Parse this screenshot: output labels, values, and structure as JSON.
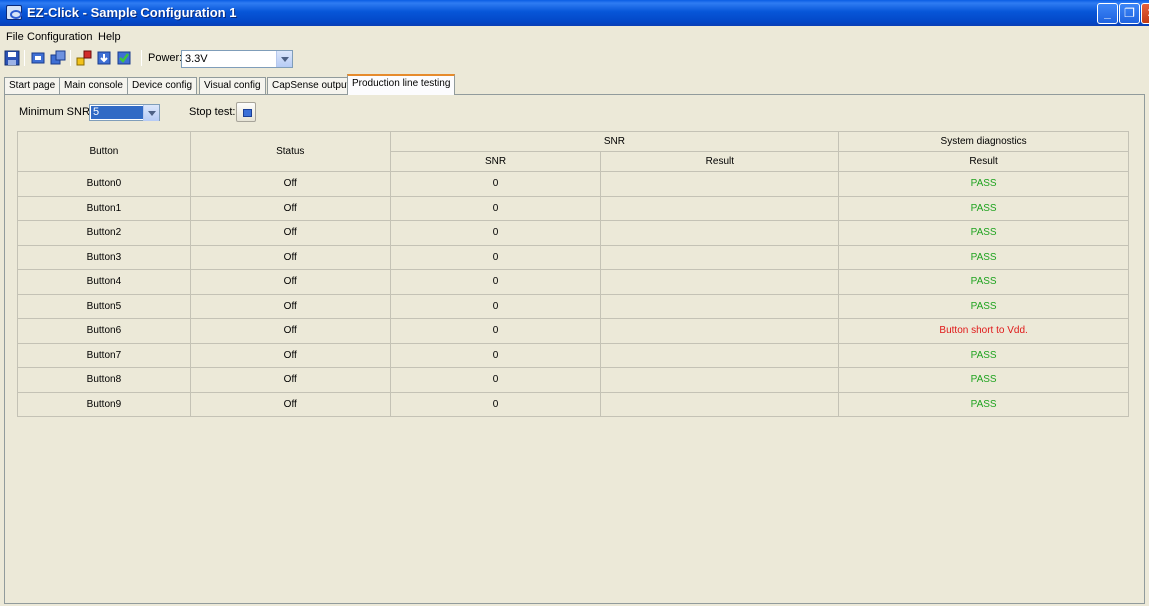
{
  "window": {
    "title": "EZ-Click - Sample Configuration 1"
  },
  "menu": {
    "file": "File",
    "configuration": "Configuration",
    "help": "Help"
  },
  "toolbar": {
    "icons": [
      "save-icon",
      "connect-icon",
      "device-icon",
      "configure-icon",
      "download-icon",
      "verify-icon"
    ],
    "power_label": "Power:",
    "power_value": "3.3V"
  },
  "tabs": [
    "Start page",
    "Main console",
    "Device config",
    "Visual config",
    "CapSense output",
    "Production line testing"
  ],
  "active_tab": "Production line testing",
  "controls": {
    "min_snr_label": "Minimum SNR:",
    "min_snr_value": "5",
    "stop_test_label": "Stop test:"
  },
  "table": {
    "headers": {
      "button": "Button",
      "status": "Status",
      "snr_group": "SNR",
      "snr": "SNR",
      "snr_result": "Result",
      "diag_group": "System diagnostics",
      "diag_result": "Result"
    },
    "rows": [
      {
        "button": "Button0",
        "status": "Off",
        "snr": "0",
        "result": "",
        "diag": "PASS",
        "diag_state": "pass"
      },
      {
        "button": "Button1",
        "status": "Off",
        "snr": "0",
        "result": "",
        "diag": "PASS",
        "diag_state": "pass"
      },
      {
        "button": "Button2",
        "status": "Off",
        "snr": "0",
        "result": "",
        "diag": "PASS",
        "diag_state": "pass"
      },
      {
        "button": "Button3",
        "status": "Off",
        "snr": "0",
        "result": "",
        "diag": "PASS",
        "diag_state": "pass"
      },
      {
        "button": "Button4",
        "status": "Off",
        "snr": "0",
        "result": "",
        "diag": "PASS",
        "diag_state": "pass"
      },
      {
        "button": "Button5",
        "status": "Off",
        "snr": "0",
        "result": "",
        "diag": "PASS",
        "diag_state": "pass"
      },
      {
        "button": "Button6",
        "status": "Off",
        "snr": "0",
        "result": "",
        "diag": "Button short to Vdd.",
        "diag_state": "fail"
      },
      {
        "button": "Button7",
        "status": "Off",
        "snr": "0",
        "result": "",
        "diag": "PASS",
        "diag_state": "pass"
      },
      {
        "button": "Button8",
        "status": "Off",
        "snr": "0",
        "result": "",
        "diag": "PASS",
        "diag_state": "pass"
      },
      {
        "button": "Button9",
        "status": "Off",
        "snr": "0",
        "result": "",
        "diag": "PASS",
        "diag_state": "pass"
      }
    ]
  },
  "colors": {
    "pass": "#1fa31f",
    "fail": "#e01818",
    "titlebar": "#0a5de4",
    "active_tab_accent": "#e68b2c"
  }
}
